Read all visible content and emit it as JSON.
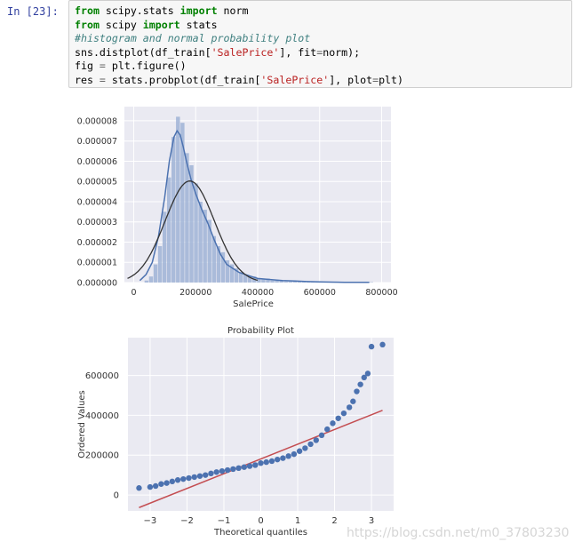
{
  "cell": {
    "prompt": "In  [23]:",
    "code_lines": [
      [
        {
          "t": "from",
          "c": "kw"
        },
        {
          "t": " scipy.stats ",
          "c": ""
        },
        {
          "t": "import",
          "c": "kw"
        },
        {
          "t": " norm",
          "c": ""
        }
      ],
      [
        {
          "t": "from",
          "c": "kw"
        },
        {
          "t": " scipy ",
          "c": ""
        },
        {
          "t": "import",
          "c": "kw"
        },
        {
          "t": " stats",
          "c": ""
        }
      ],
      [
        {
          "t": "#histogram and normal probability plot",
          "c": "cmt"
        }
      ],
      [
        {
          "t": "sns.distplot(df_train[",
          "c": ""
        },
        {
          "t": "'SalePrice'",
          "c": "str"
        },
        {
          "t": "], fit",
          "c": ""
        },
        {
          "t": "=",
          "c": "op"
        },
        {
          "t": "norm);",
          "c": ""
        }
      ],
      [
        {
          "t": "fig ",
          "c": ""
        },
        {
          "t": "=",
          "c": "op"
        },
        {
          "t": " plt.figure()",
          "c": ""
        }
      ],
      [
        {
          "t": "res ",
          "c": ""
        },
        {
          "t": "=",
          "c": "op"
        },
        {
          "t": " stats.probplot(df_train[",
          "c": ""
        },
        {
          "t": "'SalePrice'",
          "c": "str"
        },
        {
          "t": "], plot",
          "c": ""
        },
        {
          "t": "=",
          "c": "op"
        },
        {
          "t": "plt)",
          "c": ""
        }
      ]
    ]
  },
  "colors": {
    "plot_bg": "#eaeaf2",
    "grid": "#ffffff",
    "hist": "#9fb3d6",
    "kde": "#4c72b0",
    "norm_fit": "#333333",
    "points": "#4c72b0",
    "fit_line": "#c44e52",
    "tick_text": "#333333"
  },
  "chart_data": [
    {
      "type": "bar",
      "xlabel": "SalePrice",
      "ylabel": "",
      "xlim": [
        -30000,
        830000
      ],
      "ylim": [
        0,
        8.7e-06
      ],
      "xticks": [
        0,
        200000,
        400000,
        600000,
        800000
      ],
      "xtick_labels": [
        "0",
        "200000",
        "400000",
        "600000",
        "800000"
      ],
      "yticks": [
        0,
        1e-06,
        2e-06,
        3e-06,
        4e-06,
        5e-06,
        6e-06,
        7e-06,
        8e-06
      ],
      "ytick_labels": [
        "0.000000",
        "0.000001",
        "0.000002",
        "0.000003",
        "0.000004",
        "0.000005",
        "0.000006",
        "0.000007",
        "0.000008"
      ],
      "hist_bin_width": 14500,
      "hist_bins_start": [
        35000,
        49500,
        64000,
        78500,
        93000,
        107500,
        122000,
        136500,
        151000,
        165500,
        180000,
        194500,
        209000,
        223500,
        238000,
        252500,
        267000,
        281500,
        296000,
        310500,
        325000,
        339500,
        354000,
        368500,
        383000,
        397500,
        412000,
        426500,
        441000,
        455500,
        470000,
        484500,
        499000,
        513500,
        528000,
        542500,
        557000,
        571500,
        586000,
        600500,
        615000,
        629500,
        644000,
        658500,
        673000,
        687500,
        702000,
        716500,
        731000,
        745500,
        760000
      ],
      "hist_density": [
        1e-07,
        3e-07,
        9e-07,
        1.8e-06,
        3.5e-06,
        5.2e-06,
        7.2e-06,
        8.2e-06,
        7.9e-06,
        6.4e-06,
        5.8e-06,
        4.9e-06,
        4e-06,
        3.6e-06,
        3.1e-06,
        2.3e-06,
        1.8e-06,
        1.5e-06,
        1.1e-06,
        9e-07,
        7e-07,
        5e-07,
        4e-07,
        3e-07,
        3e-07,
        2e-07,
        2e-07,
        2e-07,
        1e-07,
        1e-07,
        1e-07,
        5e-08,
        5e-08,
        5e-08,
        5e-08,
        5e-08,
        5e-08,
        3e-08,
        3e-08,
        3e-08,
        3e-08,
        2e-08,
        2e-08,
        2e-08,
        2e-08,
        2e-08,
        2e-08,
        2e-08,
        2e-08,
        2e-08,
        2e-08
      ],
      "kde": {
        "x": [
          20000,
          40000,
          60000,
          80000,
          100000,
          115000,
          130000,
          140000,
          150000,
          160000,
          170000,
          185000,
          200000,
          220000,
          240000,
          260000,
          280000,
          300000,
          320000,
          340000,
          360000,
          380000,
          400000,
          440000,
          480000,
          520000,
          560000,
          600000,
          640000,
          680000,
          720000,
          760000
        ],
        "y": [
          1e-07,
          4e-07,
          1e-06,
          2.3e-06,
          4.2e-06,
          6e-06,
          7.2e-06,
          7.5e-06,
          7.3e-06,
          6.7e-06,
          6e-06,
          5.1e-06,
          4.4e-06,
          3.6e-06,
          2.9e-06,
          2.1e-06,
          1.4e-06,
          9e-07,
          7e-07,
          5e-07,
          4e-07,
          3e-07,
          2e-07,
          1.5e-07,
          1e-07,
          8e-08,
          5e-08,
          3e-08,
          2e-08,
          1e-08,
          1e-08,
          1e-08
        ]
      },
      "norm_fit": {
        "mean": 180921,
        "std": 79443
      }
    },
    {
      "type": "scatter",
      "title": "Probability Plot",
      "xlabel": "Theoretical quantiles",
      "ylabel": "Ordered Values",
      "xlim": [
        -3.6,
        3.6
      ],
      "ylim": [
        -80000,
        790000
      ],
      "xticks": [
        -3,
        -2,
        -1,
        0,
        1,
        2,
        3
      ],
      "xtick_labels": [
        "−3",
        "−2",
        "−1",
        "0",
        "1",
        "2",
        "3"
      ],
      "yticks": [
        0,
        200000,
        400000,
        600000
      ],
      "ytick_labels": [
        "0",
        "200000",
        "400000",
        "600000"
      ],
      "points": {
        "x": [
          -3.3,
          -3.0,
          -2.85,
          -2.7,
          -2.55,
          -2.4,
          -2.25,
          -2.1,
          -1.95,
          -1.8,
          -1.65,
          -1.5,
          -1.35,
          -1.2,
          -1.05,
          -0.9,
          -0.75,
          -0.6,
          -0.45,
          -0.3,
          -0.15,
          0.0,
          0.15,
          0.3,
          0.45,
          0.6,
          0.75,
          0.9,
          1.05,
          1.2,
          1.35,
          1.5,
          1.65,
          1.8,
          1.95,
          2.1,
          2.25,
          2.4,
          2.5,
          2.6,
          2.7,
          2.8,
          2.9,
          3.0,
          3.3
        ],
        "y": [
          35000,
          40000,
          45000,
          55000,
          60000,
          68000,
          75000,
          80000,
          85000,
          90000,
          95000,
          100000,
          108000,
          115000,
          120000,
          125000,
          130000,
          135000,
          140000,
          145000,
          150000,
          160000,
          165000,
          170000,
          178000,
          185000,
          195000,
          205000,
          220000,
          235000,
          255000,
          275000,
          300000,
          330000,
          360000,
          385000,
          410000,
          440000,
          470000,
          520000,
          555000,
          590000,
          610000,
          745000,
          755000
        ]
      },
      "fit_line": {
        "slope": 74000,
        "intercept": 180921,
        "x_range": [
          -3.3,
          3.3
        ]
      }
    }
  ],
  "watermark": "https://blog.csdn.net/m0_37803230"
}
